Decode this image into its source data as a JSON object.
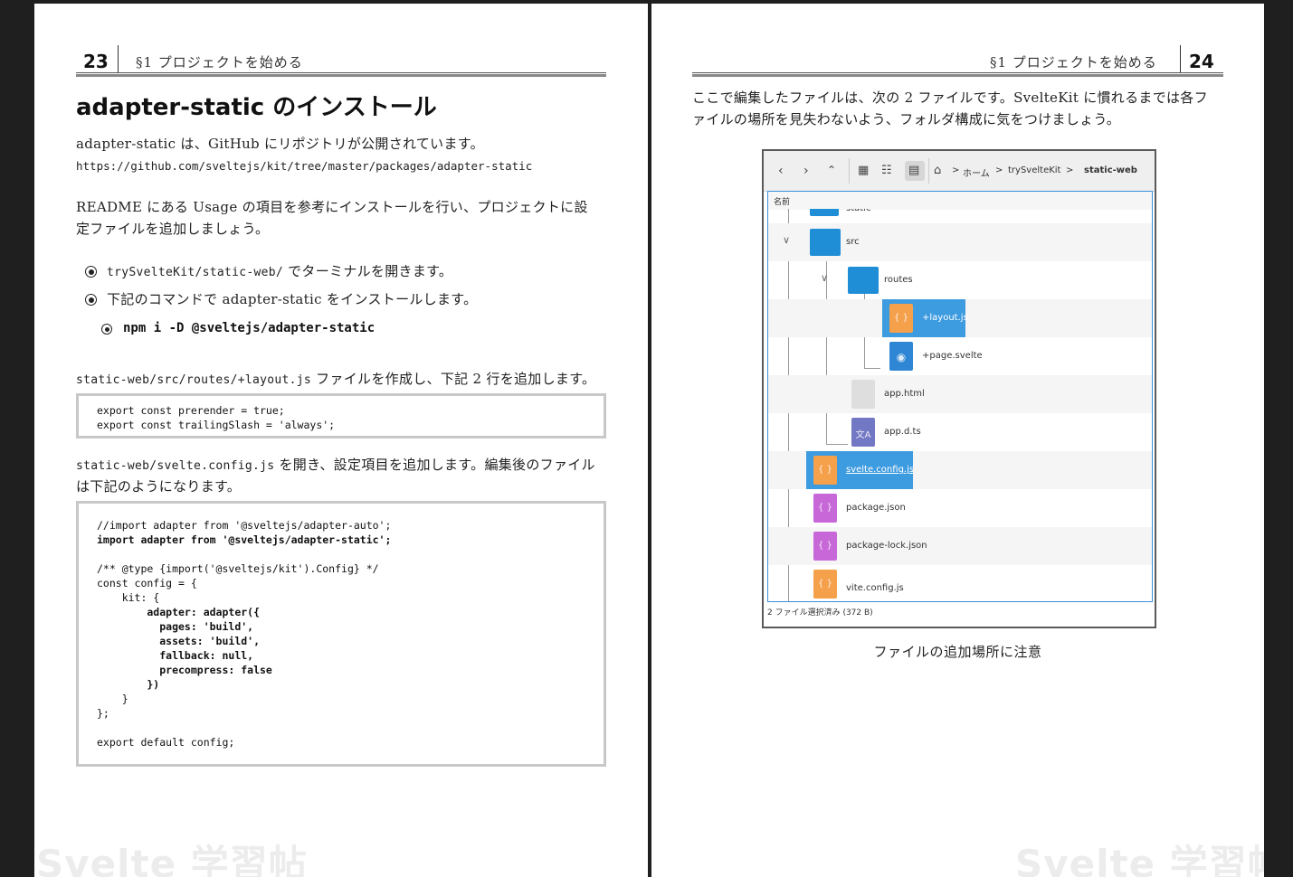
{
  "left_page": {
    "page_number": "23",
    "section": "§1 プロジェクトを始める",
    "heading": "adapter-static のインストール",
    "intro": "adapter-static は、GitHub にリポジトリが公開されています。",
    "url": "https://github.com/sveltejs/kit/tree/master/packages/adapter-static",
    "para1_line1": "README にある Usage の項目を参考にインストールを行い、プロジェクトに設",
    "para1_line2": "定ファイルを追加しましょう。",
    "bullet1_code": "trySvelteKit/static-web/",
    "bullet1_text": " でターミナルを開きます。",
    "bullet2_text": "下記のコマンドで adapter-static をインストールします。",
    "command": "npm i -D @sveltejs/adapter-static",
    "para2_code": "static-web/src/routes/+layout.js",
    "para2_text": " ファイルを作成し、下記 2 行を追加します。",
    "code1": [
      "export const prerender = true;",
      "export const trailingSlash = 'always';"
    ],
    "para3_code": "static-web/svelte.config.js",
    "para3_text": " を開き、設定項目を追加します。編集後のファイル",
    "para3_line2": "は下記のようになります。",
    "code2": [
      "//import adapter from '@sveltejs/adapter-auto';",
      "import adapter from '@sveltejs/adapter-static';",
      "",
      "/** @type {import('@sveltejs/kit').Config} */",
      "const config = {",
      "    kit: {",
      "        adapter: adapter({",
      "          pages: 'build',",
      "          assets: 'build',",
      "          fallback: null,",
      "          precompress: false",
      "        })",
      "    }",
      "};",
      "",
      "export default config;"
    ],
    "watermark": "Svelte 学習帖"
  },
  "right_page": {
    "page_number": "24",
    "section": "§1 プロジェクトを始める",
    "para_line1": "ここで編集したファイルは、次の 2 ファイルです。SvelteKit に慣れるまでは各フ",
    "para_line2": "ァイルの場所を見失わないよう、フォルダ構成に気をつけましょう。",
    "caption": "ファイルの追加場所に注意",
    "watermark": "Svelte 学習帖",
    "file_manager": {
      "breadcrumb": [
        "ホーム",
        "trySvelteKit",
        "static-web"
      ],
      "column_header": "名前",
      "status": "2 ファイル選択済み (372 B)",
      "items": [
        {
          "name": "static",
          "icon": "folder-icon"
        },
        {
          "name": "src",
          "icon": "folder-icon"
        },
        {
          "name": "routes",
          "icon": "folder-icon"
        },
        {
          "name": "+layout.js",
          "icon": "js-file-icon",
          "selected": true
        },
        {
          "name": "+page.svelte",
          "icon": "svelte-file-icon"
        },
        {
          "name": "app.html",
          "icon": "html-file-icon"
        },
        {
          "name": "app.d.ts",
          "icon": "ts-file-icon"
        },
        {
          "name": "svelte.config.js",
          "icon": "js-file-icon",
          "selected": true
        },
        {
          "name": "package.json",
          "icon": "json-file-icon"
        },
        {
          "name": "package-lock.json",
          "icon": "json-file-icon"
        },
        {
          "name": "vite.config.js",
          "icon": "js-file-icon"
        }
      ],
      "colors": {
        "selection": "#3d9be0",
        "folder": "#1f8ed6",
        "js": "#f5a04a",
        "json": "#c767d8",
        "ts": "#7378c4"
      }
    }
  }
}
